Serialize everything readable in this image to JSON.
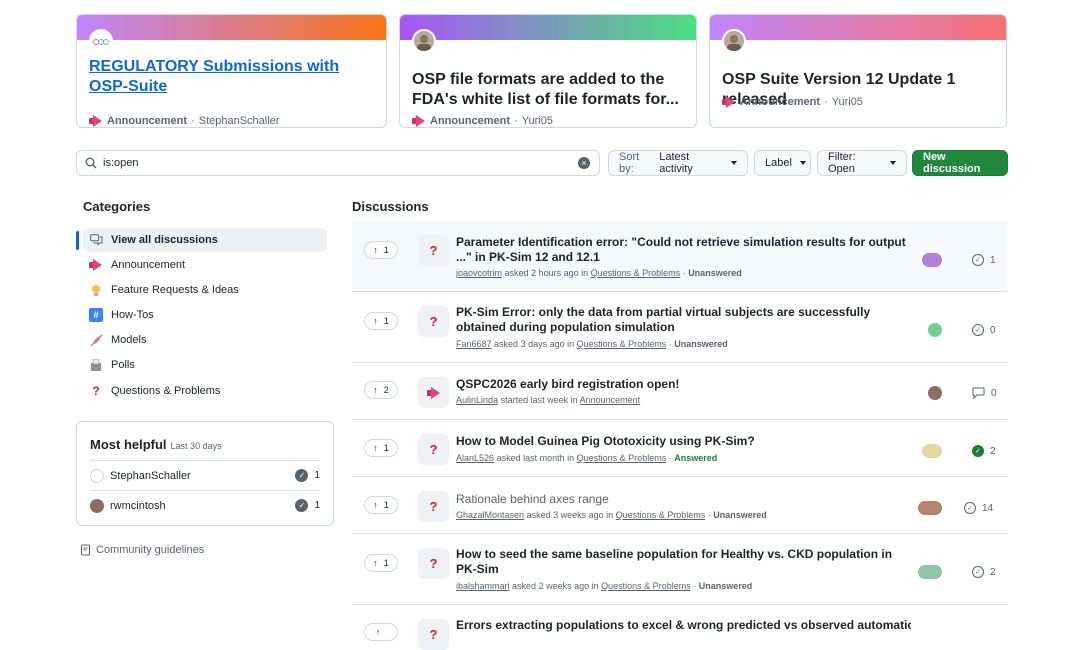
{
  "pinned": [
    {
      "title": "REGULATORY Submissions with OSP-Suite",
      "category": "Announcement",
      "author": "StephanSchaller",
      "colors": [
        "#c084fc",
        "#f97316"
      ]
    },
    {
      "title": "OSP file formats are added to the FDA's white list of file formats for...",
      "category": "Announcement",
      "author": "Yuri05",
      "colors": [
        "#a855f7",
        "#4ade80"
      ]
    },
    {
      "title": "OSP Suite Version 12 Update 1 released",
      "category": "Announcement",
      "author": "Yuri05",
      "colors": [
        "#c084fc",
        "#f87171"
      ]
    }
  ],
  "search": {
    "value": "is:open"
  },
  "toolbar": {
    "sort_label": "Sort by:",
    "sort_value": "Latest activity",
    "label": "Label",
    "filter": "Filter: Open",
    "new_discussion": "New discussion"
  },
  "sidebar": {
    "heading": "Categories",
    "items": [
      {
        "label": "View all discussions",
        "icon": "comments-icon"
      },
      {
        "label": "Announcement",
        "icon": "megaphone-icon"
      },
      {
        "label": "Feature Requests & Ideas",
        "icon": "lightbulb-icon"
      },
      {
        "label": "How-Tos",
        "icon": "hash-icon"
      },
      {
        "label": "Models",
        "icon": "syringe-icon"
      },
      {
        "label": "Polls",
        "icon": "ballot-box-icon"
      },
      {
        "label": "Questions & Problems",
        "icon": "question-icon"
      }
    ]
  },
  "most_helpful": {
    "title": "Most helpful",
    "subtitle": "Last 30 days",
    "users": [
      {
        "name": "StephanSchaller",
        "count": "1"
      },
      {
        "name": "rwmcintosh",
        "count": "1"
      }
    ]
  },
  "guidelines": "Community guidelines",
  "discussions": {
    "heading": "Discussions",
    "items": [
      {
        "votes": "1",
        "icon": "question-icon",
        "title": "Parameter Identification error: \"Could not retrieve simulation results for output ...\" in PK-Sim 12 and 12.1",
        "author": "joaovcotrim",
        "verb": "asked",
        "when": "2 hours ago",
        "category": "Questions & Problems",
        "status": "Unanswered",
        "count": "1",
        "count_icon": "check-circle-icon"
      },
      {
        "votes": "1",
        "icon": "question-icon",
        "title": "PK-Sim Error: only the data from partial virtual subjects are successfully obtained during population simulation",
        "author": "Fan6687",
        "verb": "asked",
        "when": "3 days ago",
        "category": "Questions & Problems",
        "status": "Unanswered",
        "count": "0",
        "count_icon": "check-circle-icon"
      },
      {
        "votes": "2",
        "icon": "megaphone-icon",
        "title": "QSPC2026 early bird registration open!",
        "author": "AulinLinda",
        "verb": "started",
        "when": "last week",
        "category": "Announcement",
        "status": "",
        "count": "0",
        "count_icon": "comment-icon"
      },
      {
        "votes": "1",
        "icon": "question-icon",
        "title": "How to Model Guinea Pig Ototoxicity using PK-Sim?",
        "author": "AlanL526",
        "verb": "asked",
        "when": "last month",
        "category": "Questions & Problems",
        "status": "Answered",
        "count": "2",
        "count_icon": "check-circle-filled-icon"
      },
      {
        "votes": "1",
        "icon": "question-icon",
        "title": "Rationale behind axes range",
        "author": "GhazalMontaseri",
        "verb": "asked",
        "when": "3 weeks ago",
        "category": "Questions & Problems",
        "status": "Unanswered",
        "count": "14",
        "count_icon": "check-circle-icon"
      },
      {
        "votes": "1",
        "icon": "question-icon",
        "title": "How to seed the same baseline population for Healthy vs. CKD population in PK-Sim",
        "author": "ibalshammari",
        "verb": "asked",
        "when": "2 weeks ago",
        "category": "Questions & Problems",
        "status": "Unanswered",
        "count": "2",
        "count_icon": "check-circle-icon"
      },
      {
        "votes": "",
        "icon": "question-icon",
        "title": "Errors extracting populations to excel & wrong predicted vs observed automatic",
        "author": "",
        "verb": "",
        "when": "",
        "category": "",
        "status": "",
        "count": "",
        "count_icon": ""
      }
    ]
  }
}
